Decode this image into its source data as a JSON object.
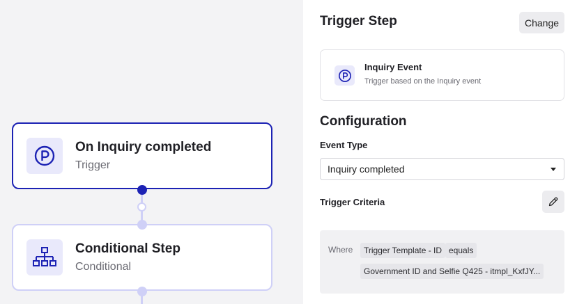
{
  "canvas": {
    "nodes": [
      {
        "title": "On Inquiry completed",
        "subtitle": "Trigger",
        "icon": "persona-p-icon"
      },
      {
        "title": "Conditional Step",
        "subtitle": "Conditional",
        "icon": "hierarchy-icon"
      }
    ]
  },
  "panel": {
    "title": "Trigger Step",
    "change_label": "Change",
    "event_card": {
      "name": "Inquiry Event",
      "description": "Trigger based on the Inquiry event",
      "icon": "persona-p-icon"
    },
    "configuration_title": "Configuration",
    "event_type_label": "Event Type",
    "event_type_value": "Inquiry completed",
    "trigger_criteria_label": "Trigger Criteria",
    "criteria": {
      "where_label": "Where",
      "field": "Trigger Template - ID",
      "operator": "equals",
      "value": "Government ID and Selfie Q425 - itmpl_KxfJY..."
    }
  },
  "colors": {
    "accent": "#1c22b4",
    "accent_light": "#cfd0f7",
    "icon_bg": "#e9e9fb",
    "canvas_bg": "#f3f3f5"
  }
}
